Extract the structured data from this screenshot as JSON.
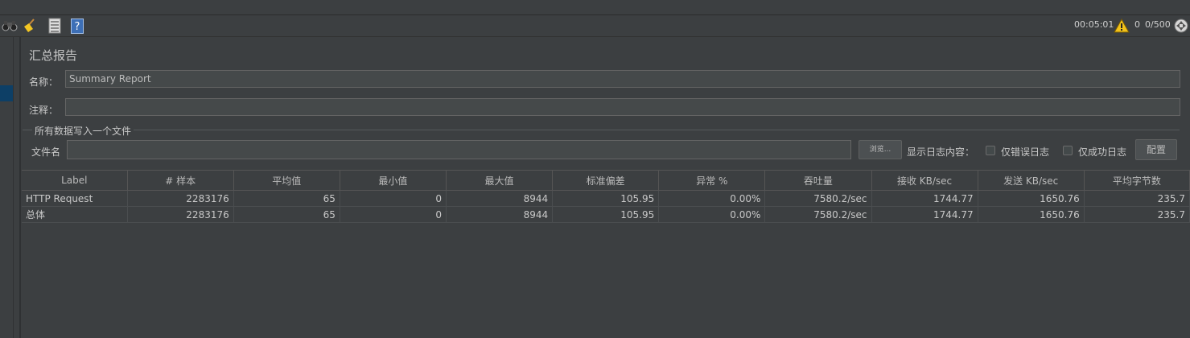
{
  "toolbar": {
    "icons": [
      "binoculars-icon",
      "broom-icon",
      "list-icon",
      "help-icon"
    ],
    "help_glyph": "?",
    "elapsed": "00:05:01",
    "warning_count": "0",
    "threads": "0/500"
  },
  "panel": {
    "title": "汇总报告",
    "name_label": "名称：",
    "name_value": "Summary Report",
    "comment_label": "注释：",
    "comment_value": "",
    "file_group_title": "所有数据写入一个文件",
    "filename_label": "文件名",
    "filename_value": "",
    "browse_label": "浏览...",
    "log_display_label": "显示日志内容：",
    "errors_only_label": "仅错误日志",
    "success_only_label": "仅成功日志",
    "configure_label": "配置"
  },
  "table": {
    "columns": [
      "Label",
      "# 样本",
      "平均值",
      "最小值",
      "最大值",
      "标准偏差",
      "异常 %",
      "吞吐量",
      "接收 KB/sec",
      "发送 KB/sec",
      "平均字节数"
    ],
    "rows": [
      [
        "HTTP Request",
        "2283176",
        "65",
        "0",
        "8944",
        "105.95",
        "0.00%",
        "7580.2/sec",
        "1744.77",
        "1650.76",
        "235.7"
      ],
      [
        "总体",
        "2283176",
        "65",
        "0",
        "8944",
        "105.95",
        "0.00%",
        "7580.2/sec",
        "1744.77",
        "1650.76",
        "235.7"
      ]
    ]
  },
  "colors": {
    "background": "#3c3f41",
    "field": "#45494a",
    "selection": "#0d3f66",
    "warning": "#f2c21a"
  }
}
